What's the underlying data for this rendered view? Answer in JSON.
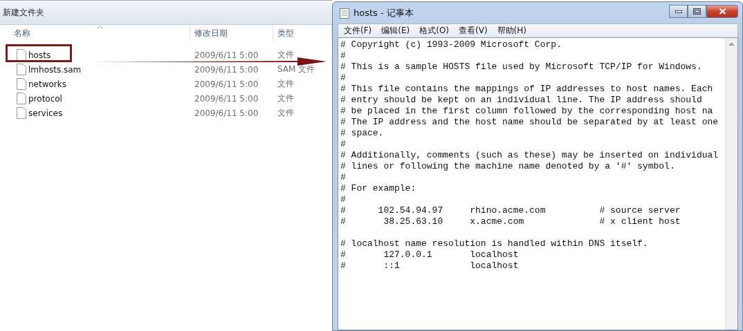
{
  "explorer": {
    "title": "新建文件夹",
    "columns": [
      {
        "label": "名称",
        "sorted": true
      },
      {
        "label": "修改日期",
        "sorted": false
      },
      {
        "label": "类型",
        "sorted": false
      }
    ],
    "files": [
      {
        "name": "hosts",
        "date": "2009/6/11 5:00",
        "type": "文件",
        "highlighted": true
      },
      {
        "name": "lmhosts.sam",
        "date": "2009/6/11 5:00",
        "type": "SAM 文件",
        "highlighted": false
      },
      {
        "name": "networks",
        "date": "2009/6/11 5:00",
        "type": "文件",
        "highlighted": false
      },
      {
        "name": "protocol",
        "date": "2009/6/11 5:00",
        "type": "文件",
        "highlighted": false
      },
      {
        "name": "services",
        "date": "2009/6/11 5:00",
        "type": "文件",
        "highlighted": false
      }
    ]
  },
  "notepad": {
    "title": "hosts - 记事本",
    "menu": [
      "文件(F)",
      "编辑(E)",
      "格式(O)",
      "查看(V)",
      "帮助(H)"
    ],
    "blocks": [
      [
        "# Copyright (c) 1993-2009 Microsoft Corp.",
        "#",
        "# This is a sample HOSTS file used by Microsoft TCP/IP for Windows.",
        "#",
        "# This file contains the mappings of IP addresses to host names. Each",
        "# entry should be kept on an individual line. The IP address should",
        "# be placed in the first column followed by the corresponding host na",
        "# The IP address and the host name should be separated by at least one",
        "# space.",
        "#",
        "# Additionally, comments (such as these) may be inserted on individual",
        "# lines or following the machine name denoted by a '#' symbol.",
        "#",
        "# For example:",
        "#",
        "#      102.54.94.97     rhino.acme.com          # source server",
        "#       38.25.63.10     x.acme.com              # x client host"
      ],
      [
        "# localhost name resolution is handled within DNS itself.",
        "#       127.0.0.1       localhost",
        "#       ::1             localhost"
      ]
    ]
  }
}
